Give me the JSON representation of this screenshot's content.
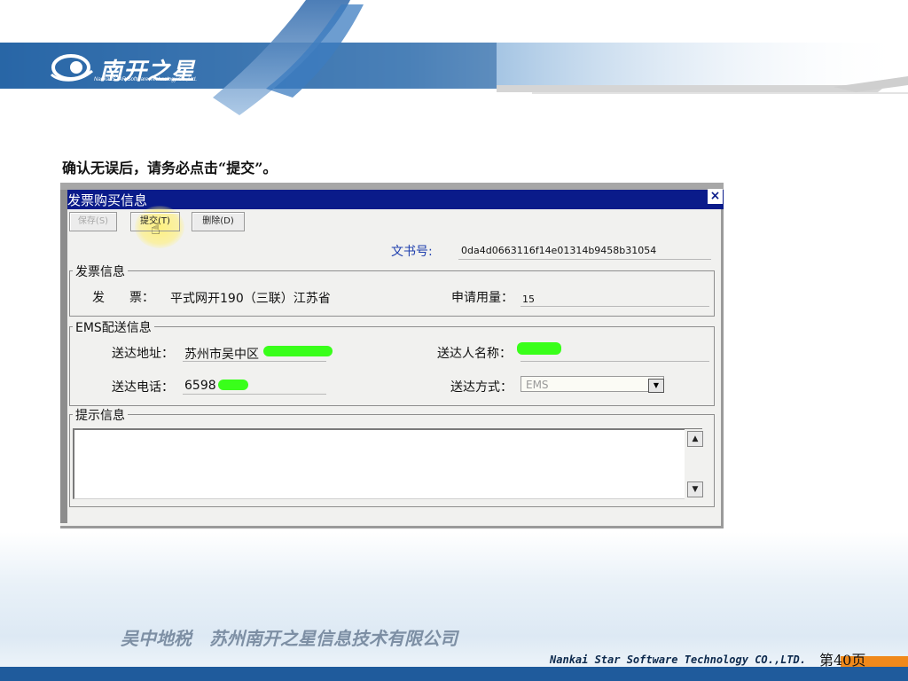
{
  "brand": {
    "logo_text": "南开之星",
    "logo_sub": "Nankai STAR Software Technology Co.,Ltd."
  },
  "instruction": "确认无误后，请务必点击“提交”。",
  "dialog": {
    "title": "发票购买信息",
    "close_label": "×",
    "toolbar": {
      "save": "保存(S)",
      "submit": "提交(T)",
      "delete": "删除(D)"
    },
    "doc_no": {
      "label": "文书号:",
      "value": "0da4d0663116f14e01314b9458b31054"
    },
    "invoice_group": {
      "title": "发票信息",
      "invoice_label": "发　　票：",
      "invoice_value": "平式网开190（三联）江苏省",
      "quantity_label": "申请用量：",
      "quantity_value": "15"
    },
    "ems_group": {
      "title": "EMS配送信息",
      "address_label": "送达地址：",
      "address_value": "苏州市吴中区",
      "recipient_label": "送达人名称：",
      "recipient_value": "",
      "phone_label": "送达电话：",
      "phone_value": "6598",
      "method_label": "送达方式：",
      "method_value": "EMS"
    },
    "notice_group": {
      "title": "提示信息",
      "content": ""
    }
  },
  "footer": {
    "company": "吴中地税　苏州南开之星信息技术有限公司",
    "english": "Nankai Star Software Technology CO.,LTD.",
    "page": "第40页"
  },
  "colors": {
    "titlebar": "#0a1b8a",
    "footer_bar": "#1f5b9c",
    "accent_orange": "#f0891b",
    "redaction": "#39ff1a"
  }
}
